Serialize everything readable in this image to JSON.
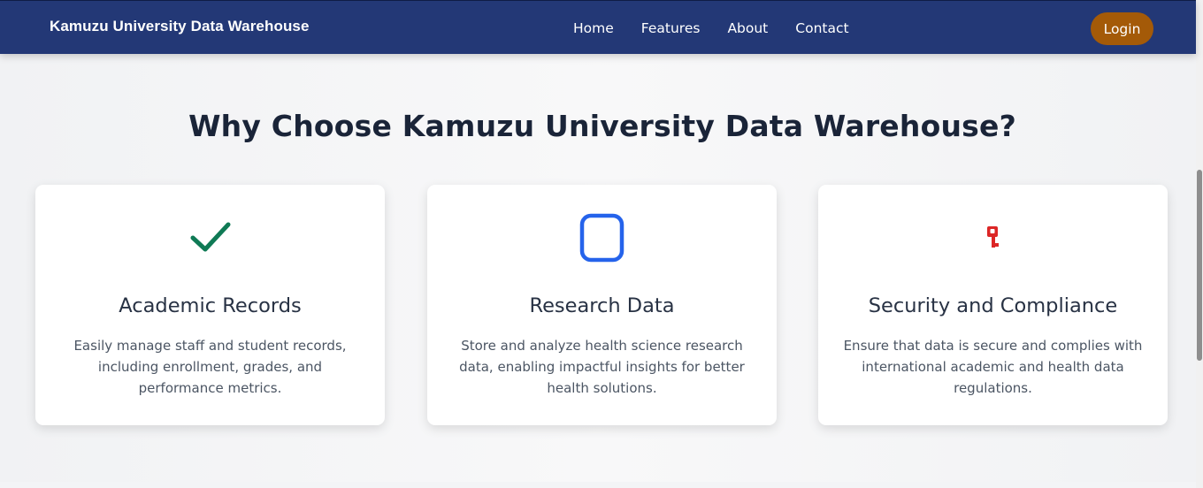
{
  "header": {
    "brand": "Kamuzu University Data Warehouse",
    "nav": [
      "Home",
      "Features",
      "About",
      "Contact"
    ],
    "login_label": "Login"
  },
  "features": {
    "heading": "Why Choose Kamuzu University Data Warehouse?",
    "cards": [
      {
        "icon": "checkmark-icon",
        "icon_color": "#0f7a55",
        "title": "Academic Records",
        "description": "Easily manage staff and student records, including enrollment, grades, and performance metrics."
      },
      {
        "icon": "square-icon",
        "icon_color": "#2563eb",
        "title": "Research Data",
        "description": "Store and analyze health science research data, enabling impactful insights for better health solutions."
      },
      {
        "icon": "key-icon",
        "icon_color": "#dc2626",
        "title": "Security and Compliance",
        "description": "Ensure that data is secure and complies with international academic and health data regulations."
      }
    ]
  },
  "colors": {
    "header_bg": "#233876",
    "login_bg": "#a45a08",
    "heading_text": "#1a2438"
  }
}
